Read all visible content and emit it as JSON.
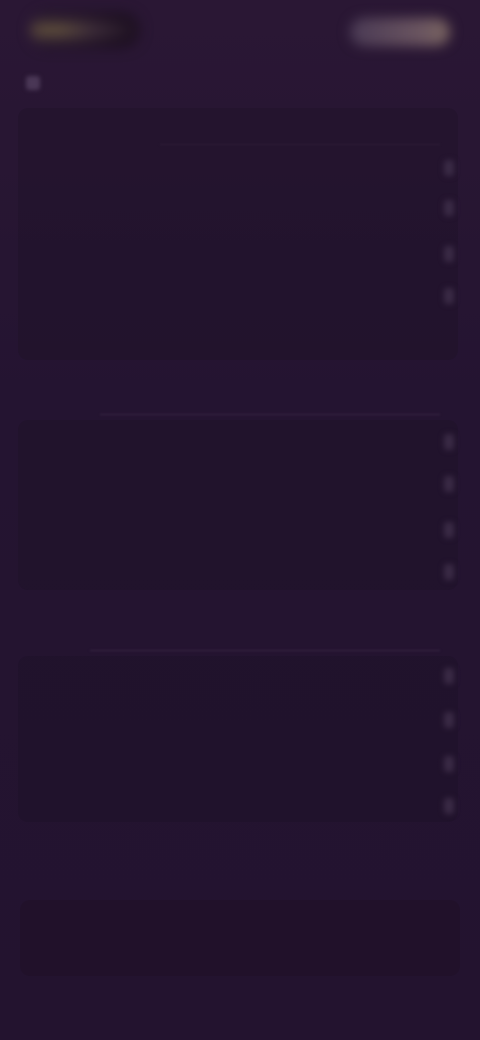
{
  "header": {
    "logo_alt": "",
    "action_label": ""
  },
  "sections": [
    {
      "title": "",
      "items": [
        "",
        "",
        "",
        "",
        "",
        ""
      ]
    },
    {
      "title": "",
      "items": [
        "",
        "",
        "",
        ""
      ]
    },
    {
      "title": "",
      "items": [
        "",
        "",
        "",
        ""
      ]
    }
  ],
  "danger": {
    "label": ""
  },
  "footer": {
    "center_label": ""
  },
  "colors": {
    "background": "#26142f",
    "accent": "#c0475a",
    "text": "#9686a6"
  },
  "icons": {
    "section": "settings-group-icon",
    "chevron": "chevron-right-icon"
  }
}
